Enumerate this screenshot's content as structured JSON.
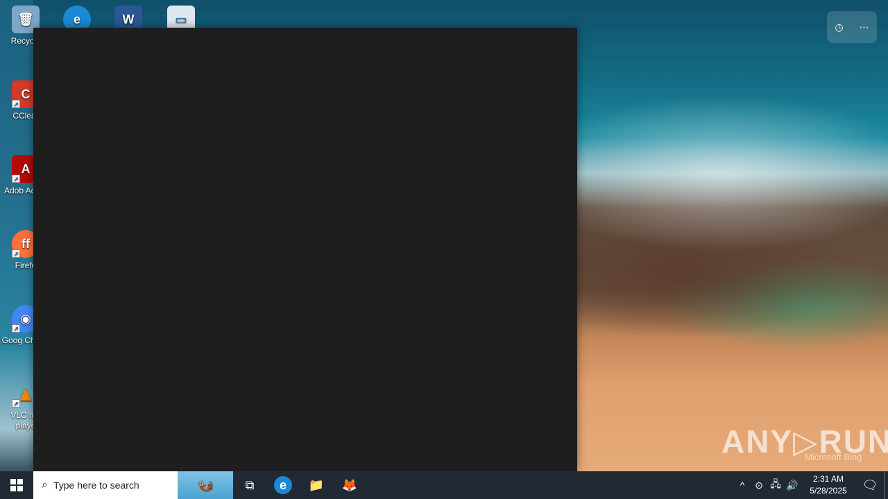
{
  "desktop": {
    "icons": [
      {
        "label": "Recycle",
        "glyph": "🗑",
        "color": "#7ea7c7"
      },
      {
        "label": "",
        "glyph": "e",
        "color": "#1a8ad6"
      },
      {
        "label": "",
        "glyph": "W",
        "color": "#2b5797"
      },
      {
        "label": "",
        "glyph": "▭",
        "color": "#dfe7ef"
      },
      {
        "label": "CClear",
        "glyph": "C",
        "color": "#d33a2c"
      },
      {
        "label": "Adob Acrob",
        "glyph": "A",
        "color": "#b30b00"
      },
      {
        "label": "Firefo",
        "glyph": "ff",
        "color": "#ff7139"
      },
      {
        "label": "Goog Chrom",
        "glyph": "◉",
        "color": "#4285f4"
      },
      {
        "label": "VLC me playe",
        "glyph": "▲",
        "color": "#f08a00"
      }
    ],
    "shortcut_arrow": "↗"
  },
  "widget": {
    "icons": [
      "clock-icon",
      "more-icon"
    ],
    "clock_glyph": "◷",
    "more_glyph": "⋯"
  },
  "watermark": {
    "anyrun": "ANY▷RUN",
    "bing": "Microsoft Bing"
  },
  "taskbar": {
    "search_placeholder": "Type here to search",
    "search_glyph": "⌕",
    "otter_glyph": "🦦",
    "task_view_glyph": "⧉",
    "edge_glyph": "e",
    "explorer_glyph": "📁",
    "firefox_glyph": "🦊",
    "tray": {
      "chevron": "^",
      "meet_now": "⊙",
      "network": "🖧",
      "volume": "🔊"
    },
    "time": "2:31 AM",
    "date": "5/28/2025",
    "notifications_glyph": "🗨"
  }
}
